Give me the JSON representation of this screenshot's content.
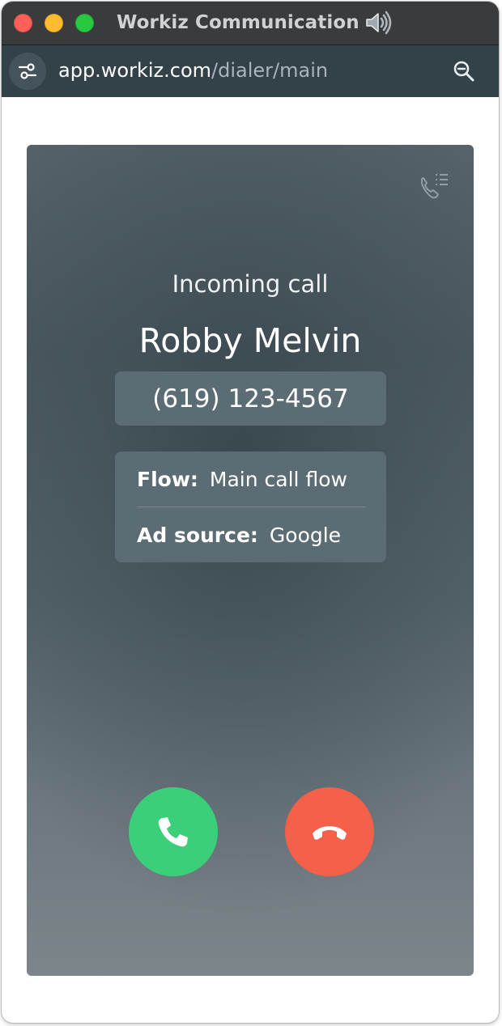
{
  "window": {
    "title": "Workiz Communication",
    "audio_icon": "speaker-wave-icon"
  },
  "address_bar": {
    "domain": "app.workiz.com",
    "path": "/dialer/main",
    "site_settings_icon": "sliders-icon",
    "zoom_icon": "zoom-out-icon"
  },
  "dialer": {
    "call_log_icon": "call-log-icon",
    "status": "Incoming call",
    "caller_name": "Robby Melvin",
    "phone_number": "(619) 123-4567",
    "details": [
      {
        "label": "Flow:",
        "value": "Main call flow"
      },
      {
        "label": "Ad source:",
        "value": "Google"
      }
    ],
    "accept_icon": "phone-icon",
    "decline_icon": "hang-up-icon"
  },
  "colors": {
    "accept": "#3bcf7a",
    "decline": "#f5604a",
    "card": "#5c6c75",
    "address_bar": "#334149"
  }
}
